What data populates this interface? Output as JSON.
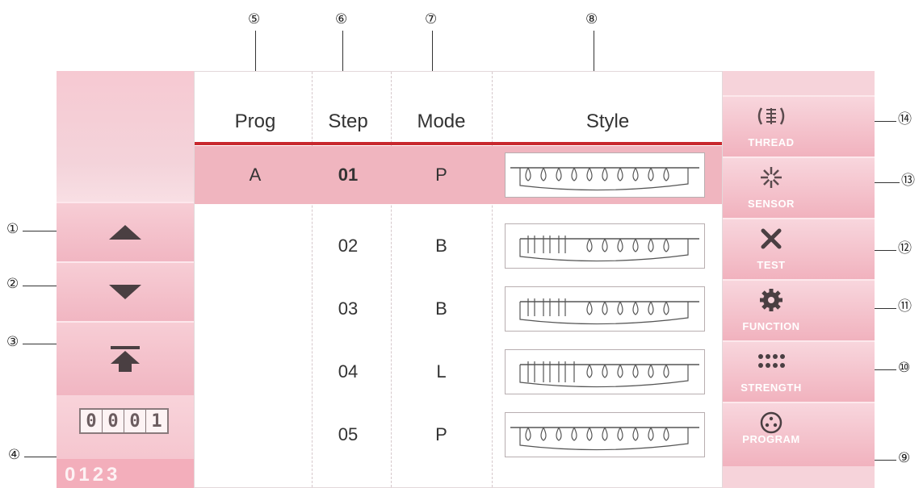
{
  "callouts": [
    "①",
    "②",
    "③",
    "④",
    "⑤",
    "⑥",
    "⑦",
    "⑧",
    "⑨",
    "⑩",
    "⑪",
    "⑫",
    "⑬",
    "⑭"
  ],
  "table": {
    "headers": [
      "Prog",
      "Step",
      "Mode",
      "Style"
    ],
    "rows": [
      {
        "prog": "A",
        "step": "01",
        "mode": "P"
      },
      {
        "prog": "",
        "step": "02",
        "mode": "B"
      },
      {
        "prog": "",
        "step": "03",
        "mode": "B"
      },
      {
        "prog": "",
        "step": "04",
        "mode": "L"
      },
      {
        "prog": "",
        "step": "05",
        "mode": "P"
      }
    ]
  },
  "left": {
    "buttons": [
      "up-arrow",
      "down-arrow",
      "top-arrow"
    ],
    "counter_digits": [
      "0",
      "0",
      "0",
      "1"
    ],
    "counter_value": "0123"
  },
  "right": {
    "buttons": [
      {
        "label": "THREAD",
        "icon": "thread-icon"
      },
      {
        "label": "SENSOR",
        "icon": "sensor-icon"
      },
      {
        "label": "TEST",
        "icon": "test-icon"
      },
      {
        "label": "FUNCTION",
        "icon": "gear-icon"
      },
      {
        "label": "STRENGTH",
        "icon": "dots-icon"
      },
      {
        "label": "PROGRAM",
        "icon": "program-icon"
      }
    ]
  },
  "colors": {
    "panel_pink": "#f4c3cc",
    "selected_row": "#f0b5bf",
    "header_rule": "#c8282e"
  }
}
